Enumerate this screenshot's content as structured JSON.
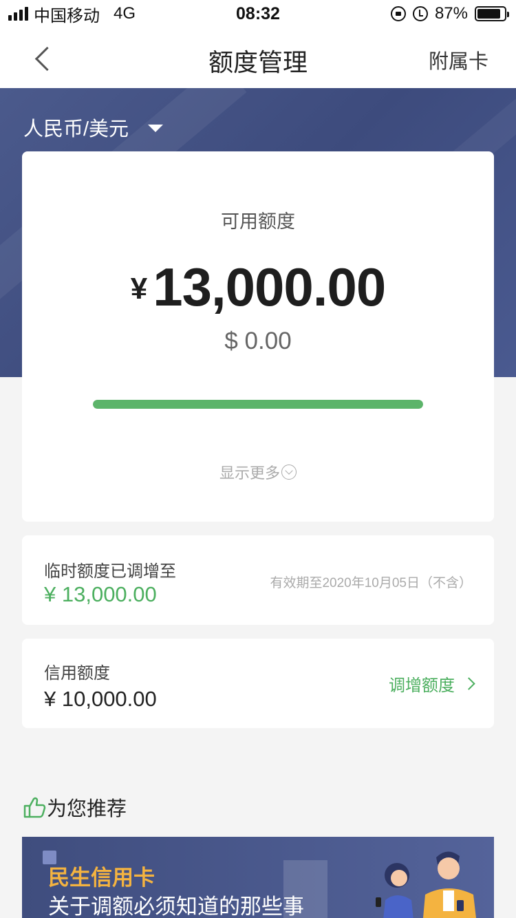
{
  "status_bar": {
    "carrier": "中国移动",
    "network": "4G",
    "time": "08:32",
    "battery_percent": "87%",
    "battery_level": 0.87,
    "icons": [
      "signal-icon",
      "rotation-lock-icon",
      "alarm-icon",
      "battery-icon"
    ]
  },
  "nav": {
    "title": "额度管理",
    "right_action": "附属卡",
    "back_icon": "chevron-left-icon"
  },
  "currency_selector": {
    "label": "人民币/美元",
    "icon": "caret-down-icon"
  },
  "available": {
    "label": "可用额度",
    "currency_symbol": "¥",
    "amount": "13,000.00",
    "usd_amount": "$ 0.00",
    "progress_fraction": 1.0,
    "progress_color": "#5cb46a",
    "show_more": "显示更多"
  },
  "temp_limit": {
    "label": "临时额度已调增至",
    "amount": "¥ 13,000.00",
    "valid_until": "有效期至2020年10月05日（不含）"
  },
  "credit_limit": {
    "label": "信用额度",
    "amount": "¥ 10,000.00",
    "action": "调增额度"
  },
  "recommend": {
    "title": "为您推荐",
    "icon": "thumbs-up-icon",
    "banner": {
      "brand": "民生信用卡",
      "subtitle": "关于调额必须知道的那些事"
    }
  },
  "colors": {
    "header_blue": "#3f4d7e",
    "accent_green": "#4caf5f",
    "banner_orange": "#f4b340"
  }
}
